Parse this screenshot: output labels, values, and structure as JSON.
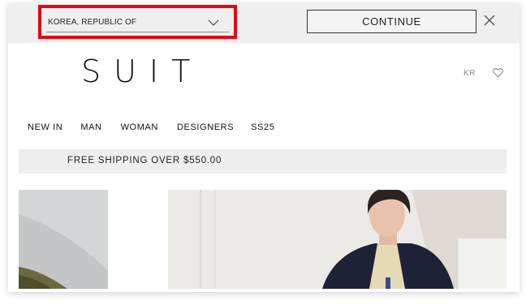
{
  "country_bar": {
    "selected_country": "KOREA, REPUBLIC OF",
    "continue_label": "CONTINUE"
  },
  "header": {
    "logo": "SUIT",
    "language": "KR"
  },
  "nav": {
    "items": [
      "NEW IN",
      "MAN",
      "WOMAN",
      "DESIGNERS",
      "SS25"
    ]
  },
  "banner": {
    "text": "FREE SHIPPING OVER $550.00"
  },
  "colors": {
    "highlight_border": "#e30613",
    "bar_background": "#efefef"
  },
  "icons": {
    "dropdown": "chevron-down-icon",
    "close": "close-icon",
    "wishlist": "heart-icon"
  }
}
